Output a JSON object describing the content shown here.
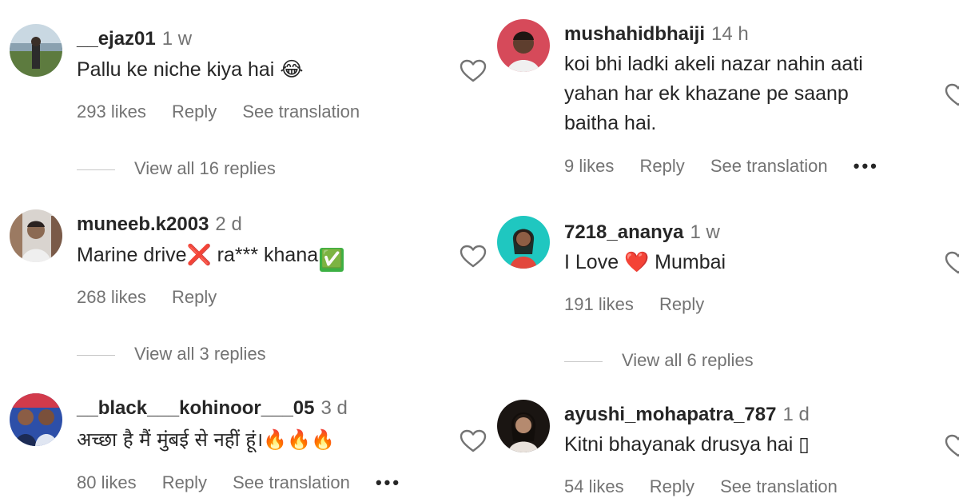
{
  "left": {
    "comments": [
      {
        "username": "__ejaz01",
        "time": "1 w",
        "text": "Pallu ke niche kiya hai",
        "emoji": "😂",
        "likes": "293 likes",
        "reply": "Reply",
        "translation": "See translation",
        "view_replies": "View all 16 replies"
      },
      {
        "username": "muneeb.k2003",
        "time": "2 d",
        "text_a": "Marine drive",
        "emoji_a": "❌",
        "text_b": " ra*** khana",
        "emoji_b": "✅",
        "likes": "268 likes",
        "reply": "Reply",
        "view_replies": "View all 3 replies"
      },
      {
        "username": "__black___kohinoor___05",
        "time": "3 d",
        "text": "अच्छा है मैं मुंबई से नहीं हूं।",
        "emoji": "🔥🔥🔥",
        "likes": "80 likes",
        "reply": "Reply",
        "translation": "See translation",
        "more": "•••"
      }
    ]
  },
  "right": {
    "comments": [
      {
        "username": "mushahidbhaiji",
        "time": "14 h",
        "text_line1": "koi bhi ladki akeli nazar nahin aati",
        "text_line2": "yahan har ek khazane pe saanp",
        "text_line3": "baitha hai.",
        "likes": "9 likes",
        "reply": "Reply",
        "translation": "See translation",
        "more": "•••"
      },
      {
        "username": "7218_ananya",
        "time": "1 w",
        "text_a": "I Love",
        "emoji": "❤️",
        "text_b": "Mumbai",
        "likes": "191 likes",
        "reply": "Reply",
        "view_replies": "View all 6 replies"
      },
      {
        "username": "ayushi_mohapatra_787",
        "time": "1 d",
        "text": "Kitni bhayanak drusya hai ▯",
        "likes": "54 likes",
        "reply": "Reply",
        "translation": "See translation"
      }
    ]
  },
  "icons": {
    "heart": "heart-outline-icon",
    "more": "more-dots-icon"
  },
  "colors": {
    "text": "#262626",
    "secondary": "#737373",
    "divider": "#c7c7c7",
    "red_cross": "#e0312b",
    "green_check": "#3cb043",
    "fire": "#f4801f"
  }
}
